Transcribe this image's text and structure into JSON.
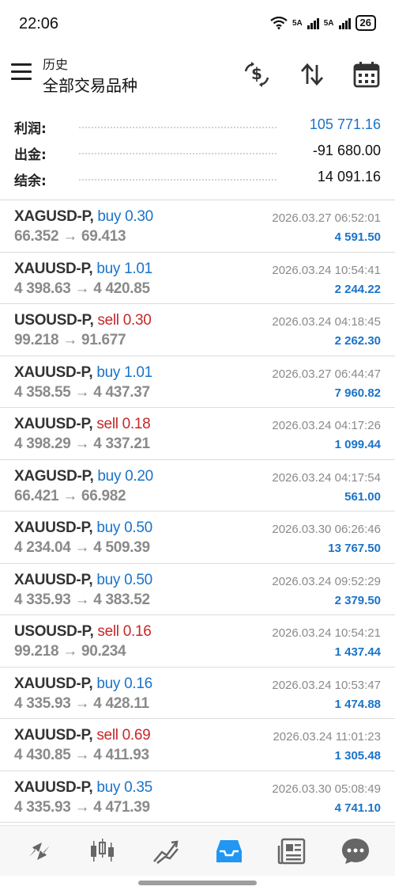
{
  "status_bar": {
    "time": "22:06",
    "network_1": "5A",
    "network_2": "5A",
    "battery": "26",
    "wifi_icon": "wifi-icon",
    "signal_icon": "signal-icon"
  },
  "header": {
    "subtitle": "历史",
    "title": "全部交易品种",
    "menu_icon": "menu-icon",
    "actions": [
      {
        "icon": "currency-exchange-icon"
      },
      {
        "icon": "sort-icon"
      },
      {
        "icon": "calendar-icon"
      }
    ]
  },
  "summary": {
    "profit_label": "利润:",
    "profit_value": "105 771.16",
    "withdrawal_label": "出金:",
    "withdrawal_value": "-91 680.00",
    "balance_label": "结余:",
    "balance_value": "14 091.16"
  },
  "colors": {
    "buy": "#1a73c9",
    "sell": "#c62828",
    "profit": "#1a73c9",
    "accent": "#2196f3"
  },
  "deals": [
    {
      "symbol": "XAGUSD-P,",
      "side": "buy",
      "volume": "0.30",
      "prices": "66.352 → 69.413",
      "time": "2026.03.27 06:52:01",
      "profit": "4 591.50"
    },
    {
      "symbol": "XAUUSD-P,",
      "side": "buy",
      "volume": "1.01",
      "prices": "4 398.63 → 4 420.85",
      "time": "2026.03.24 10:54:41",
      "profit": "2 244.22"
    },
    {
      "symbol": "USOUSD-P,",
      "side": "sell",
      "volume": "0.30",
      "prices": "99.218 → 91.677",
      "time": "2026.03.24 04:18:45",
      "profit": "2 262.30"
    },
    {
      "symbol": "XAUUSD-P,",
      "side": "buy",
      "volume": "1.01",
      "prices": "4 358.55 → 4 437.37",
      "time": "2026.03.27 06:44:47",
      "profit": "7 960.82"
    },
    {
      "symbol": "XAUUSD-P,",
      "side": "sell",
      "volume": "0.18",
      "prices": "4 398.29 → 4 337.21",
      "time": "2026.03.24 04:17:26",
      "profit": "1 099.44"
    },
    {
      "symbol": "XAGUSD-P,",
      "side": "buy",
      "volume": "0.20",
      "prices": "66.421 → 66.982",
      "time": "2026.03.24 04:17:54",
      "profit": "561.00"
    },
    {
      "symbol": "XAUUSD-P,",
      "side": "buy",
      "volume": "0.50",
      "prices": "4 234.04 → 4 509.39",
      "time": "2026.03.30 06:26:46",
      "profit": "13 767.50"
    },
    {
      "symbol": "XAUUSD-P,",
      "side": "buy",
      "volume": "0.50",
      "prices": "4 335.93 → 4 383.52",
      "time": "2026.03.24 09:52:29",
      "profit": "2 379.50"
    },
    {
      "symbol": "USOUSD-P,",
      "side": "sell",
      "volume": "0.16",
      "prices": "99.218 → 90.234",
      "time": "2026.03.24 10:54:21",
      "profit": "1 437.44"
    },
    {
      "symbol": "XAUUSD-P,",
      "side": "buy",
      "volume": "0.16",
      "prices": "4 335.93 → 4 428.11",
      "time": "2026.03.24 10:53:47",
      "profit": "1 474.88"
    },
    {
      "symbol": "XAUUSD-P,",
      "side": "sell",
      "volume": "0.69",
      "prices": "4 430.85 → 4 411.93",
      "time": "2026.03.24 11:01:23",
      "profit": "1 305.48"
    },
    {
      "symbol": "XAUUSD-P,",
      "side": "buy",
      "volume": "0.35",
      "prices": "4 335.93 → 4 471.39",
      "time": "2026.03.30 05:08:49",
      "profit": "4 741.10"
    }
  ],
  "bottom_nav": [
    {
      "icon": "quotes-icon",
      "active": false
    },
    {
      "icon": "candlestick-chart-icon",
      "active": false
    },
    {
      "icon": "trade-icon",
      "active": false
    },
    {
      "icon": "history-inbox-icon",
      "active": true
    },
    {
      "icon": "news-icon",
      "active": false
    },
    {
      "icon": "chat-icon",
      "active": false
    }
  ]
}
